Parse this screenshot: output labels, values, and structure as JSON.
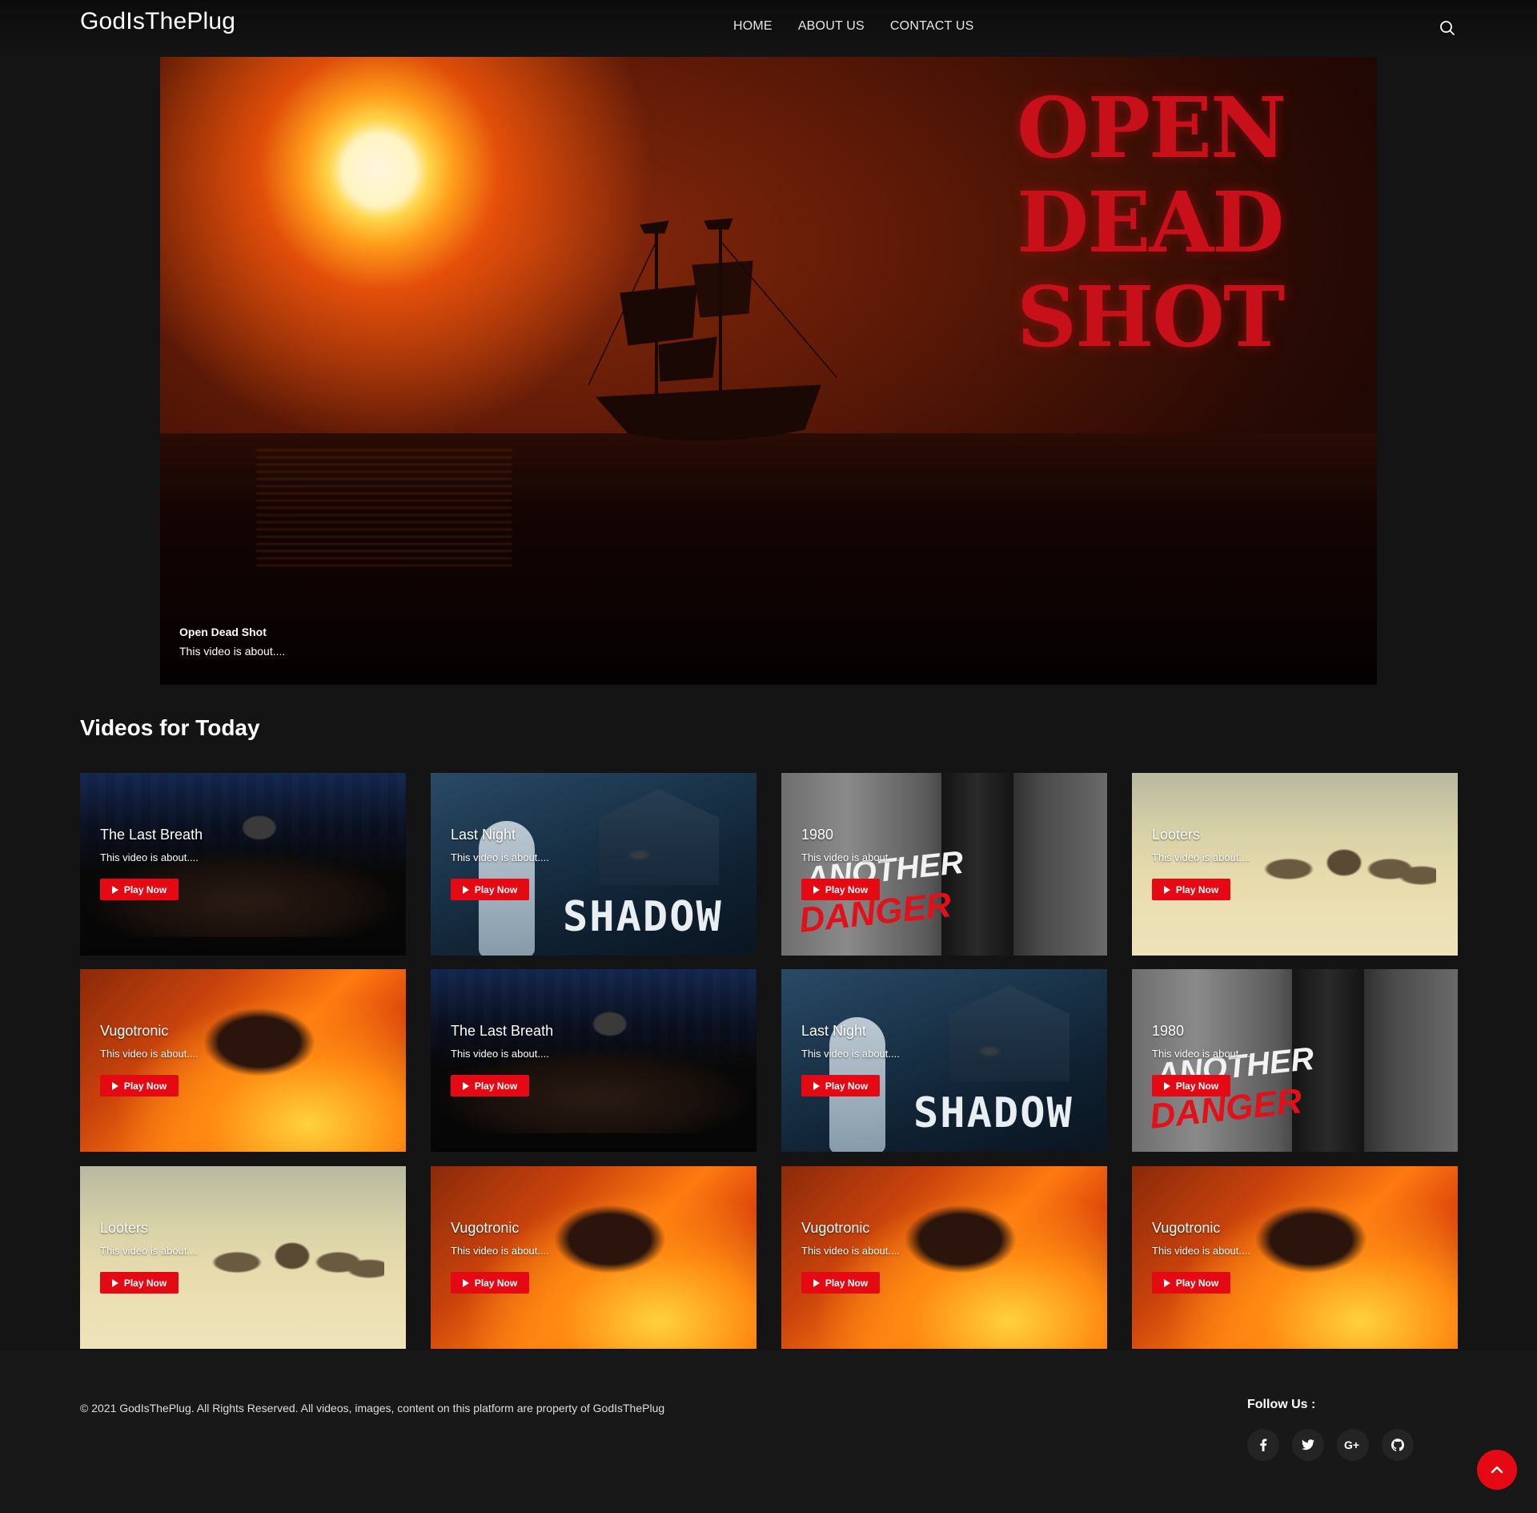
{
  "header": {
    "logo": "GodIsThePlug",
    "nav": [
      "HOME",
      "ABOUT US",
      "CONTACT US"
    ],
    "search_icon": "search-icon"
  },
  "hero": {
    "art_title_lines": [
      "OPEN",
      "DEAD",
      "SHOT"
    ],
    "caption_title": "Open Dead Shot",
    "caption_desc": "This video is about...."
  },
  "section": {
    "title": "Videos for Today"
  },
  "play_label": "Play Now",
  "cards": [
    {
      "title": "The Last Breath",
      "desc": "This video is about....",
      "theme": "breath"
    },
    {
      "title": "Last Night",
      "desc": "This video is about....",
      "theme": "night",
      "art": "SHADOW"
    },
    {
      "title": "1980",
      "desc": "This video is about....",
      "theme": "y1980",
      "art": "ANOTHER",
      "art2": "DANGER"
    },
    {
      "title": "Looters",
      "desc": "This video is about....",
      "theme": "looters"
    },
    {
      "title": "Vugotronic",
      "desc": "This video is about....",
      "theme": "vugo"
    },
    {
      "title": "The Last Breath",
      "desc": "This video is about....",
      "theme": "breath"
    },
    {
      "title": "Last Night",
      "desc": "This video is about....",
      "theme": "night",
      "art": "SHADOW"
    },
    {
      "title": "1980",
      "desc": "This video is about....",
      "theme": "y1980",
      "art": "ANOTHER",
      "art2": "DANGER"
    },
    {
      "title": "Looters",
      "desc": "This video is about....",
      "theme": "looters"
    },
    {
      "title": "Vugotronic",
      "desc": "This video is about....",
      "theme": "vugo"
    },
    {
      "title": "Vugotronic",
      "desc": "This video is about....",
      "theme": "vugo"
    },
    {
      "title": "Vugotronic",
      "desc": "This video is about....",
      "theme": "vugo"
    }
  ],
  "footer": {
    "copyright": "© 2021 GodIsThePlug. All Rights Reserved. All videos, images, content on this platform are property of GodIsThePlug",
    "follow_title": "Follow Us :",
    "socials": [
      {
        "name": "facebook-icon",
        "glyph": "f"
      },
      {
        "name": "twitter-icon",
        "glyph": "t"
      },
      {
        "name": "google-plus-icon",
        "glyph": "G+"
      },
      {
        "name": "github-icon",
        "glyph": "gh"
      }
    ]
  },
  "colors": {
    "accent": "#e50914",
    "background": "#141414",
    "hero_title": "#c8101a"
  }
}
